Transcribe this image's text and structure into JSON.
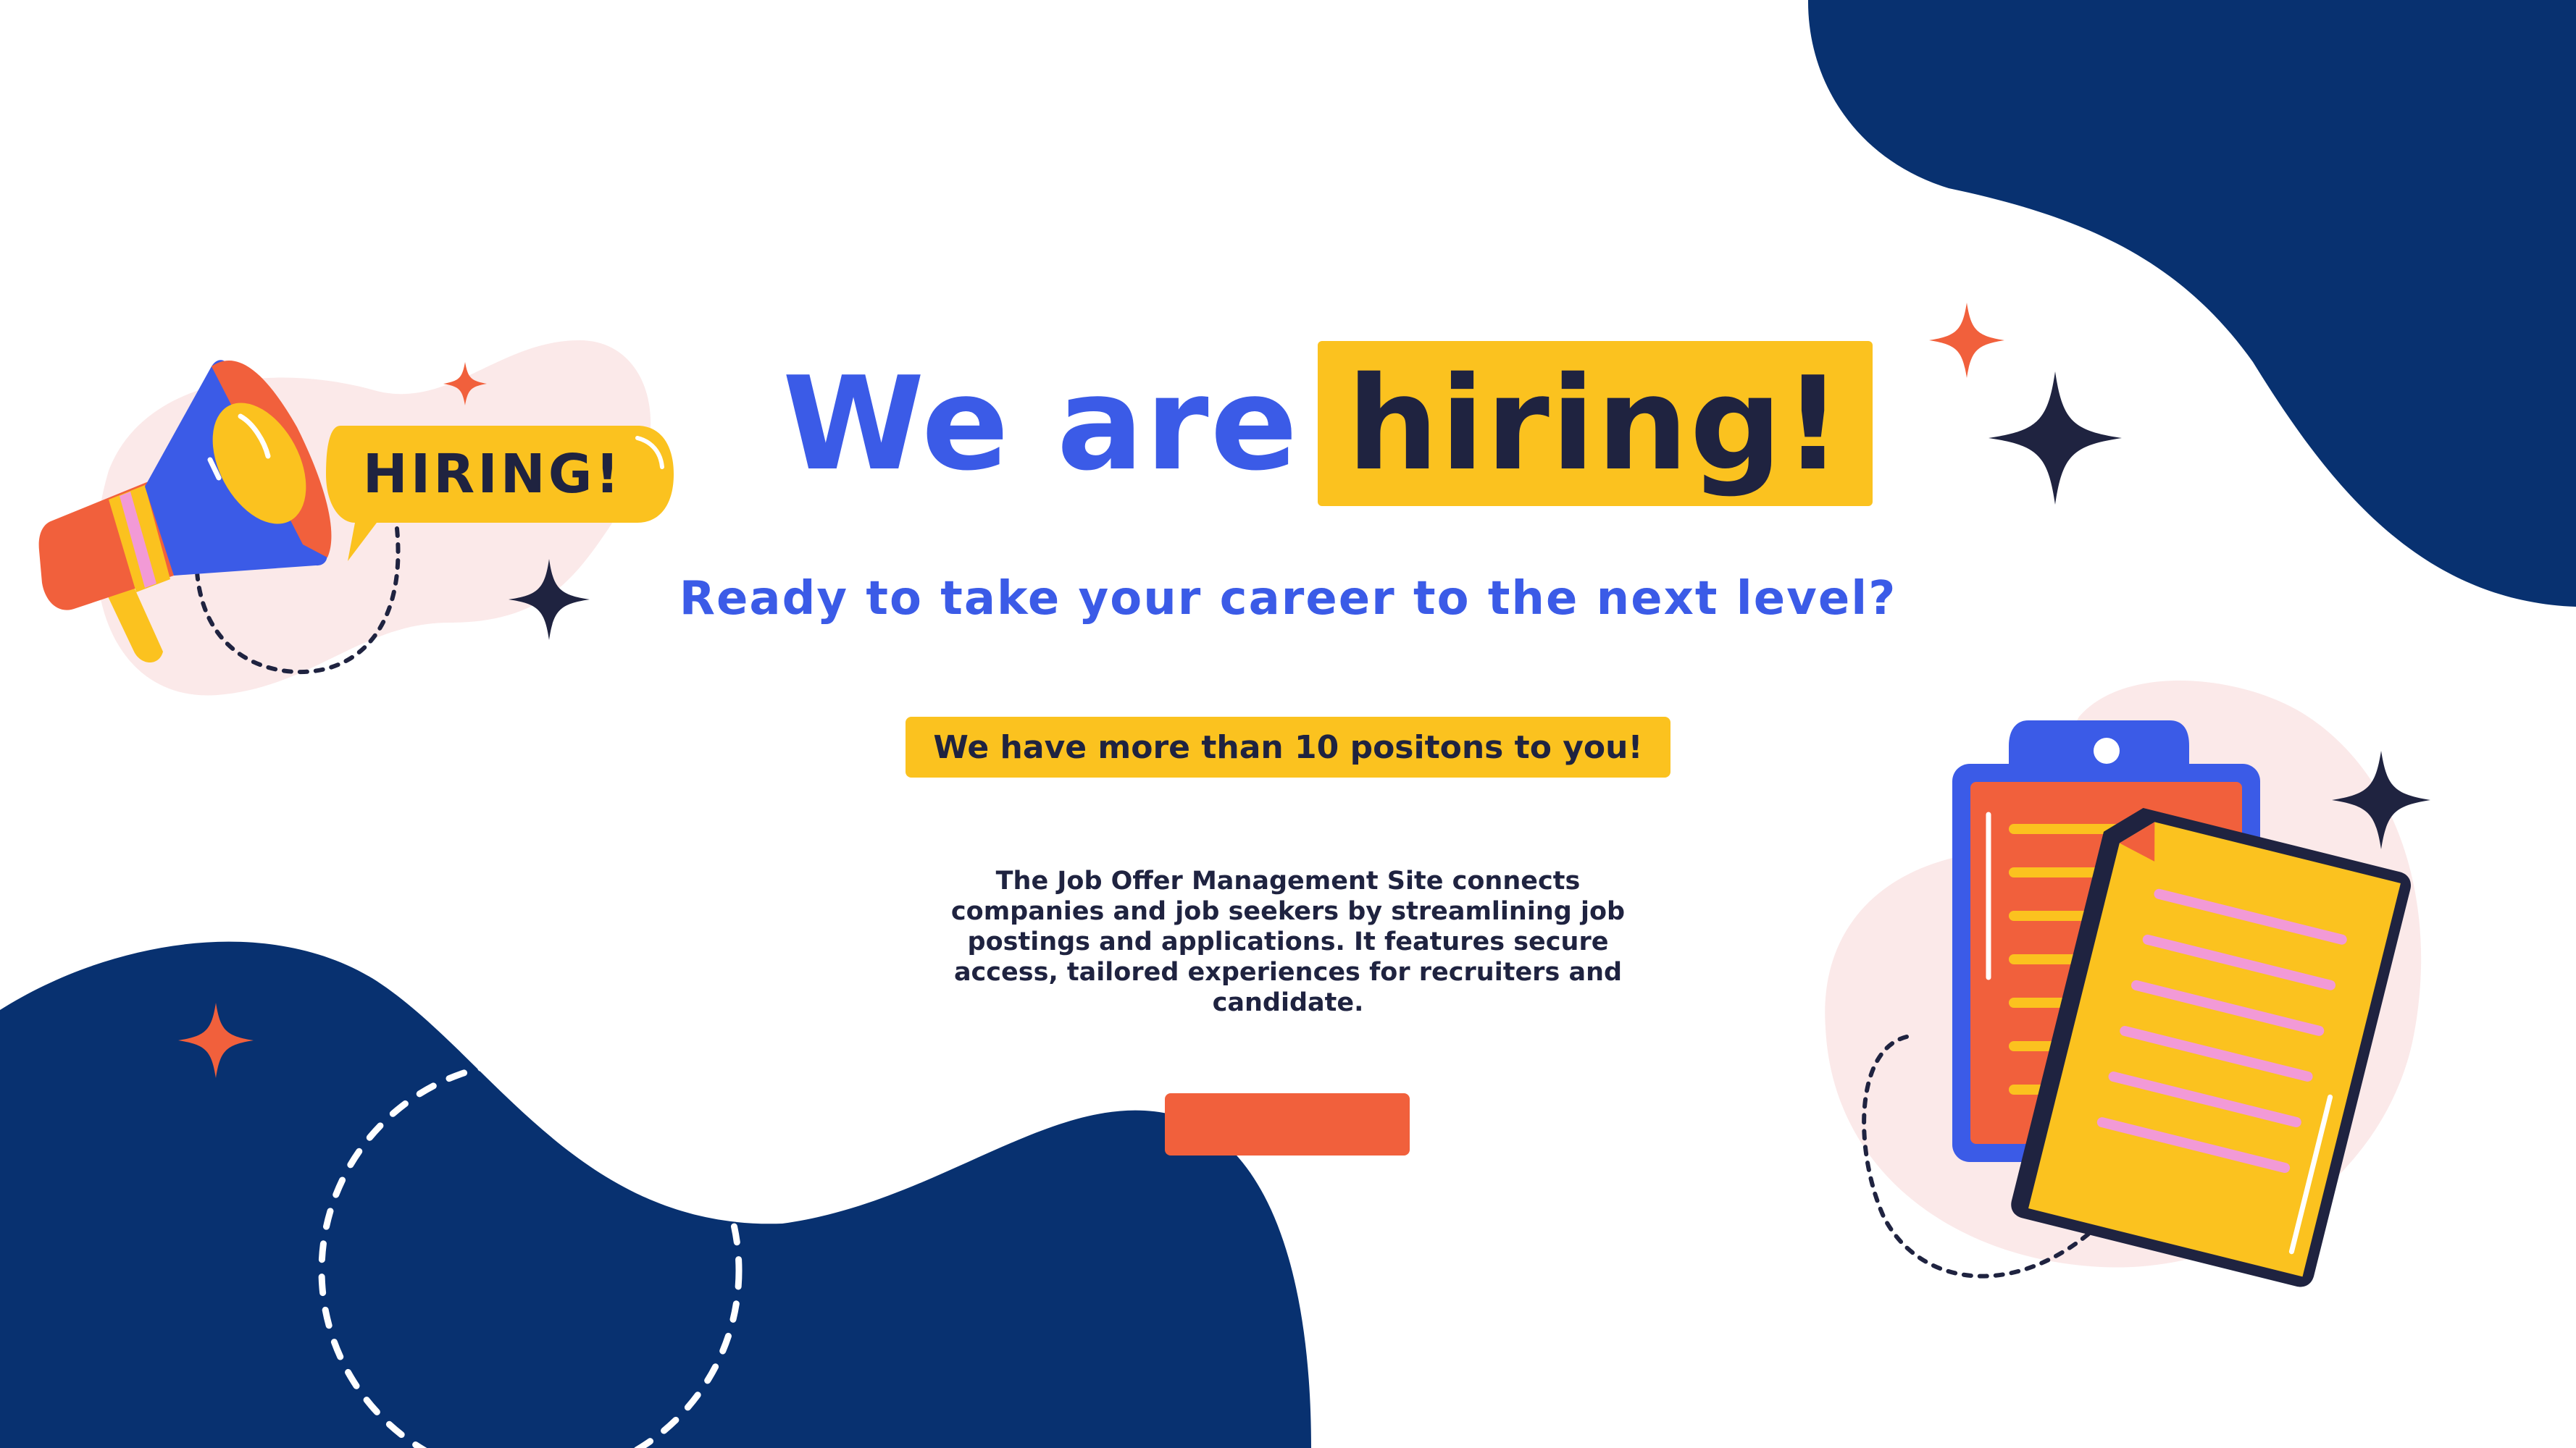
{
  "headline": {
    "lead": "We are",
    "highlight": "hiring!"
  },
  "subheadline": "Ready to take your career to the next level?",
  "positions_badge": "We have more than 10 positons to you!",
  "description": "The Job Offer Management Site connects companies and job seekers by streamlining job postings and applications. It features secure access, tailored experiences for recruiters and candidate.",
  "cta_button_label": "",
  "megaphone_bubble_text": "HIRING!",
  "icons": [
    "megaphone-icon",
    "clipboard-icon",
    "document-icon",
    "sparkle-icon"
  ],
  "colors": {
    "brand_blue": "#3b5be7",
    "navy": "#083170",
    "yellow": "#fbc21f",
    "orange": "#f1603c",
    "dark": "#1f2340",
    "blush": "#fbe9e9",
    "pink": "#f29ad6"
  }
}
